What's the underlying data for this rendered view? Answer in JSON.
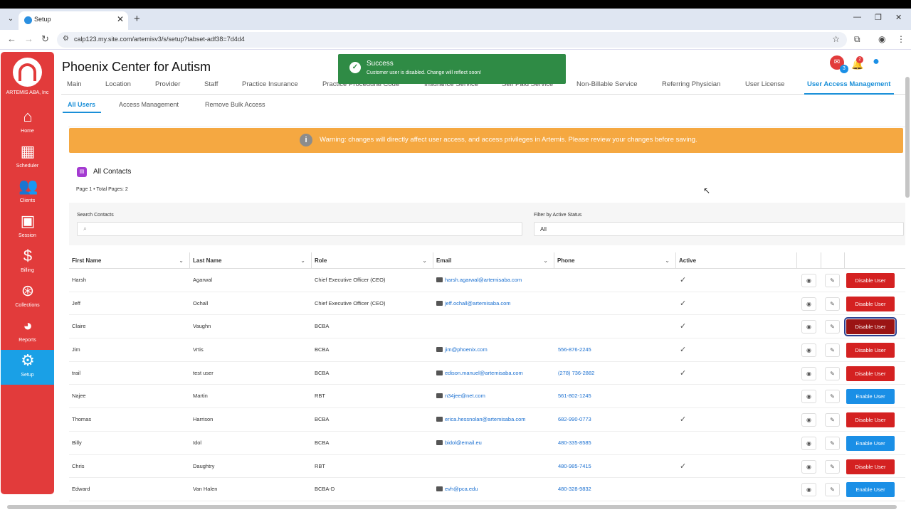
{
  "browser": {
    "tab_title": "Setup",
    "url": "calp123.my.site.com/artemisv3/s/setup?tabset-adf38=7d4d4"
  },
  "sidebar": {
    "org": "ARTEMIS ABA, Inc",
    "items": [
      {
        "label": "Home",
        "icon": "home-icon"
      },
      {
        "label": "Scheduler",
        "icon": "calendar-icon"
      },
      {
        "label": "Clients",
        "icon": "people-icon"
      },
      {
        "label": "Session",
        "icon": "session-icon"
      },
      {
        "label": "Billing",
        "icon": "dollar-icon"
      },
      {
        "label": "Collections",
        "icon": "collections-icon"
      },
      {
        "label": "Reports",
        "icon": "pie-chart-icon"
      },
      {
        "label": "Setup",
        "icon": "gear-icon"
      }
    ]
  },
  "header": {
    "org_title": "Phoenix Center for Autism",
    "badges": {
      "chat": "3",
      "bell": "2"
    }
  },
  "tabs": [
    "Main",
    "Location",
    "Provider",
    "Staff",
    "Practice Insurance",
    "Practice Procedural Code",
    "Insurance Service",
    "Self Paid Service",
    "Non-Billable Service",
    "Referring Physician",
    "User License",
    "User Access Management"
  ],
  "subtabs": [
    "All Users",
    "Access Management",
    "Remove Bulk Access"
  ],
  "toast": {
    "title": "Success",
    "message": "Customer user is disabled. Change will reflect soon!"
  },
  "warning": "Warning: changes will directly affect user access, and access privileges in Artemis. Please review your changes before saving.",
  "contacts": {
    "title": "All Contacts",
    "page_info": "Page 1 • Total Pages: 2"
  },
  "filters": {
    "search_label": "Search Contacts",
    "search_value": "",
    "status_label": "Filter by Active Status",
    "status_value": "All"
  },
  "table": {
    "headers": [
      "First Name",
      "Last Name",
      "Role",
      "Email",
      "Phone",
      "Active"
    ],
    "rows": [
      {
        "first": "Harsh",
        "last": "Agarwal",
        "role": "Chief Executive Officer (CEO)",
        "email": "harsh.agarwal@artemisaba.com",
        "phone": "",
        "active": true,
        "action": "Disable User"
      },
      {
        "first": "Jeff",
        "last": "Ochall",
        "role": "Chief Executive Officer (CEO)",
        "email": "jeff.ochall@artemisaba.com",
        "phone": "",
        "active": true,
        "action": "Disable User"
      },
      {
        "first": "Claire",
        "last": "Vaughn",
        "role": "BCBA",
        "email": "",
        "phone": "",
        "active": true,
        "action": "Disable User"
      },
      {
        "first": "Jim",
        "last": "Vrtis",
        "role": "BCBA",
        "email": "jim@phoenix.com",
        "phone": "556-876-2245",
        "active": true,
        "action": "Disable User"
      },
      {
        "first": "trail",
        "last": "test user",
        "role": "BCBA",
        "email": "edison.manuel@artemisaba.com",
        "phone": "(278) 736-2882",
        "active": true,
        "action": "Disable User"
      },
      {
        "first": "Najee",
        "last": "Martin",
        "role": "RBT",
        "email": "n34jee@net.com",
        "phone": "561-802-1245",
        "active": false,
        "action": "Enable User"
      },
      {
        "first": "Thomas",
        "last": "Harrison",
        "role": "BCBA",
        "email": "erica.hessnolan@artemisaba.com",
        "phone": "682-990-0773",
        "active": true,
        "action": "Disable User"
      },
      {
        "first": "Billy",
        "last": "Idol",
        "role": "BCBA",
        "email": "bidol@email.eu",
        "phone": "480-335-8585",
        "active": false,
        "action": "Enable User"
      },
      {
        "first": "Chris",
        "last": "Daughtry",
        "role": "RBT",
        "email": "",
        "phone": "480-985-7415",
        "active": true,
        "action": "Disable User"
      },
      {
        "first": "Edward",
        "last": "Van Halen",
        "role": "BCBA-D",
        "email": "evh@pca.edu",
        "phone": "480-328-9832",
        "active": false,
        "action": "Enable User"
      }
    ]
  }
}
